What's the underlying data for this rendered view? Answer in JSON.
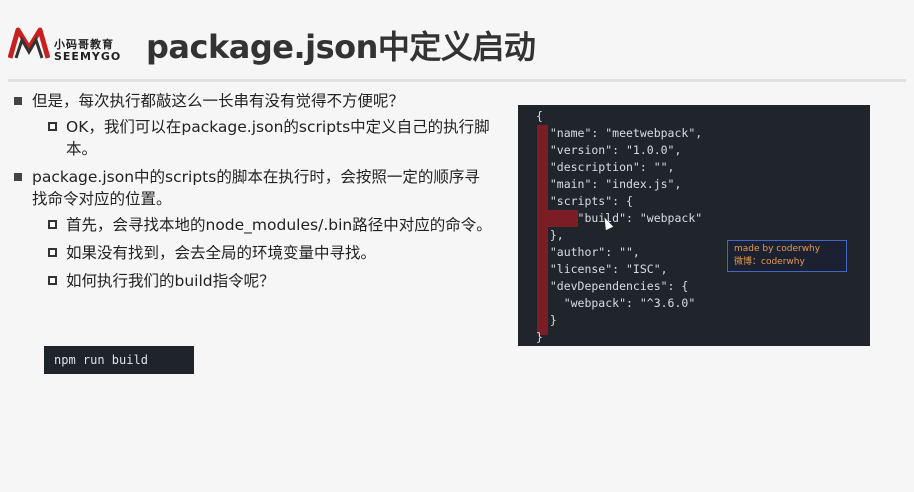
{
  "header": {
    "logo_cn": "小码哥教育",
    "logo_en": "SEEMYGO",
    "title": "package.json中定义启动"
  },
  "content": {
    "bullet1": "但是，每次执行都敲这么一长串有没有觉得不方便呢？",
    "bullet1_sub": "OK，我们可以在package.json的scripts中定义自己的执行脚本。",
    "bullet2": "package.json中的scripts的脚本在执行时，会按照一定的顺序寻找命令对应的位置。",
    "bullet2_sub1": "首先，会寻找本地的node_modules/.bin路径中对应的命令。",
    "bullet2_sub2": "如果没有找到，会去全局的环境变量中寻找。",
    "bullet2_sub3": "如何执行我们的build指令呢？",
    "code_cmd": "npm run build"
  },
  "code_panel": {
    "lines": [
      "{",
      "  \"name\": \"meetwebpack\",",
      "  \"version\": \"1.0.0\",",
      "  \"description\": \"\",",
      "  \"main\": \"index.js\",",
      "  \"scripts\": {",
      "      \"build\": \"webpack\"",
      "  },",
      "  \"author\": \"\",",
      "  \"license\": \"ISC\",",
      "  \"devDependencies\": {",
      "    \"webpack\": \"^3.6.0\"",
      "  }",
      "}"
    ],
    "watermark_line1": "made by coderwhy",
    "watermark_line2": "微博：coderwhy"
  }
}
